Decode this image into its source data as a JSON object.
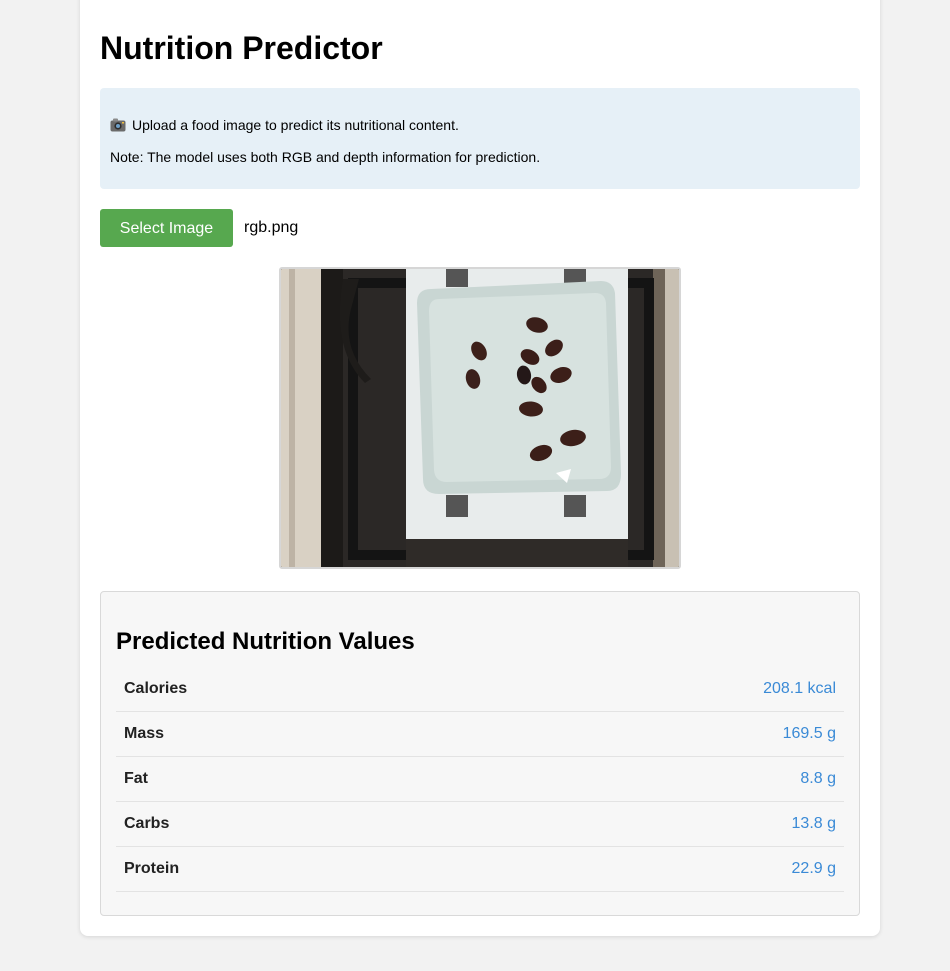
{
  "header": {
    "title": "Nutrition Predictor"
  },
  "info": {
    "icon": "camera-icon",
    "line1": "Upload a food image to predict its nutritional content.",
    "line2": "Note: The model uses both RGB and depth information for prediction."
  },
  "upload": {
    "button_label": "Select Image",
    "file_name": "rgb.png",
    "button_color": "#57a84f"
  },
  "results": {
    "title": "Predicted Nutrition Values",
    "value_color": "#3a8ad6",
    "rows": [
      {
        "label": "Calories",
        "value": "208.1 kcal"
      },
      {
        "label": "Mass",
        "value": "169.5 g"
      },
      {
        "label": "Fat",
        "value": "8.8 g"
      },
      {
        "label": "Carbs",
        "value": "13.8 g"
      },
      {
        "label": "Protein",
        "value": "22.9 g"
      }
    ]
  }
}
